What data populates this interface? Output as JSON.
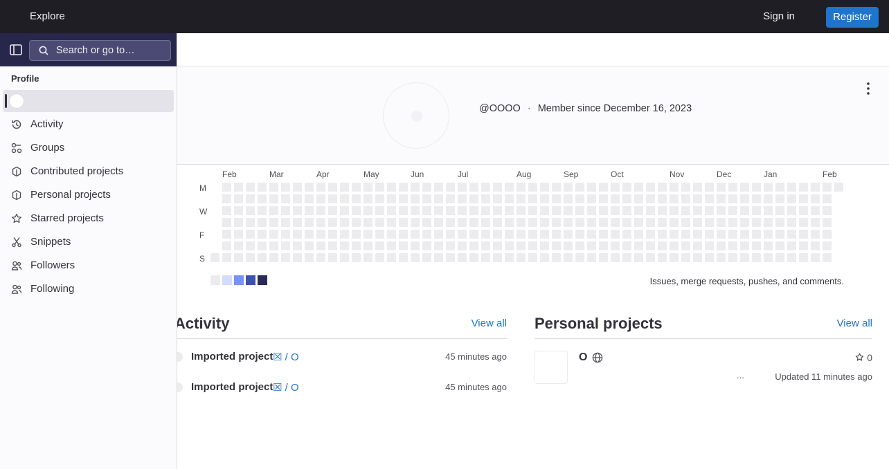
{
  "topbar": {
    "explore": "Explore",
    "signin": "Sign in",
    "register": "Register"
  },
  "sidebar": {
    "search_placeholder": "Search or go to…",
    "section_title": "Profile",
    "user_label": "ᅟ",
    "items": [
      {
        "label": "Activity",
        "icon": "history-icon"
      },
      {
        "label": "Groups",
        "icon": "group-icon"
      },
      {
        "label": "Contributed projects",
        "icon": "project-icon"
      },
      {
        "label": "Personal projects",
        "icon": "project-icon"
      },
      {
        "label": "Starred projects",
        "icon": "star-icon"
      },
      {
        "label": "Snippets",
        "icon": "snippet-icon"
      },
      {
        "label": "Followers",
        "icon": "users-icon"
      },
      {
        "label": "Following",
        "icon": "users-icon"
      }
    ]
  },
  "profile": {
    "name": "ᅟ",
    "username": "@OOOO",
    "separator": "·",
    "member_since": "Member since December 16, 2023",
    "bio": "ᅟᅟᅟᅟᅟᅟᅟᅟᅟᅟᅟᅟᅟᅟᅟᅟᅟᅟᅟᅟᅟᅟᅟᅟᅟᅟᅟᅟᅟᅟᅟᅟᅟᅟᅟᅟᅟᅟᅟᅟᅟ"
  },
  "calendar": {
    "months": [
      "Feb",
      "Mar",
      "Apr",
      "May",
      "Jun",
      "Jul",
      "Aug",
      "Sep",
      "Oct",
      "Nov",
      "Dec",
      "Jan",
      "Feb"
    ],
    "day_labels": [
      "M",
      "W",
      "F",
      "S"
    ],
    "legend_text": "Issues, merge requests, pushes, and comments.",
    "legend_colors": [
      "#ececef",
      "#d2dcff",
      "#7992f5",
      "#3f51ae",
      "#2a2b59"
    ],
    "empty_color": "#ececef"
  },
  "activity": {
    "title": "Activity",
    "view_all": "View all",
    "rows": [
      {
        "text": "Imported project",
        "link": "☒ / O",
        "time": "45 minutes ago"
      },
      {
        "text": "Imported project",
        "link": "☒ / O",
        "time": "45 minutes ago"
      }
    ]
  },
  "projects": {
    "title": "Personal projects",
    "view_all": "View all",
    "item": {
      "name": "O",
      "stars": "0",
      "ellipsis": "...",
      "updated": "Updated 11 minutes ago"
    }
  }
}
